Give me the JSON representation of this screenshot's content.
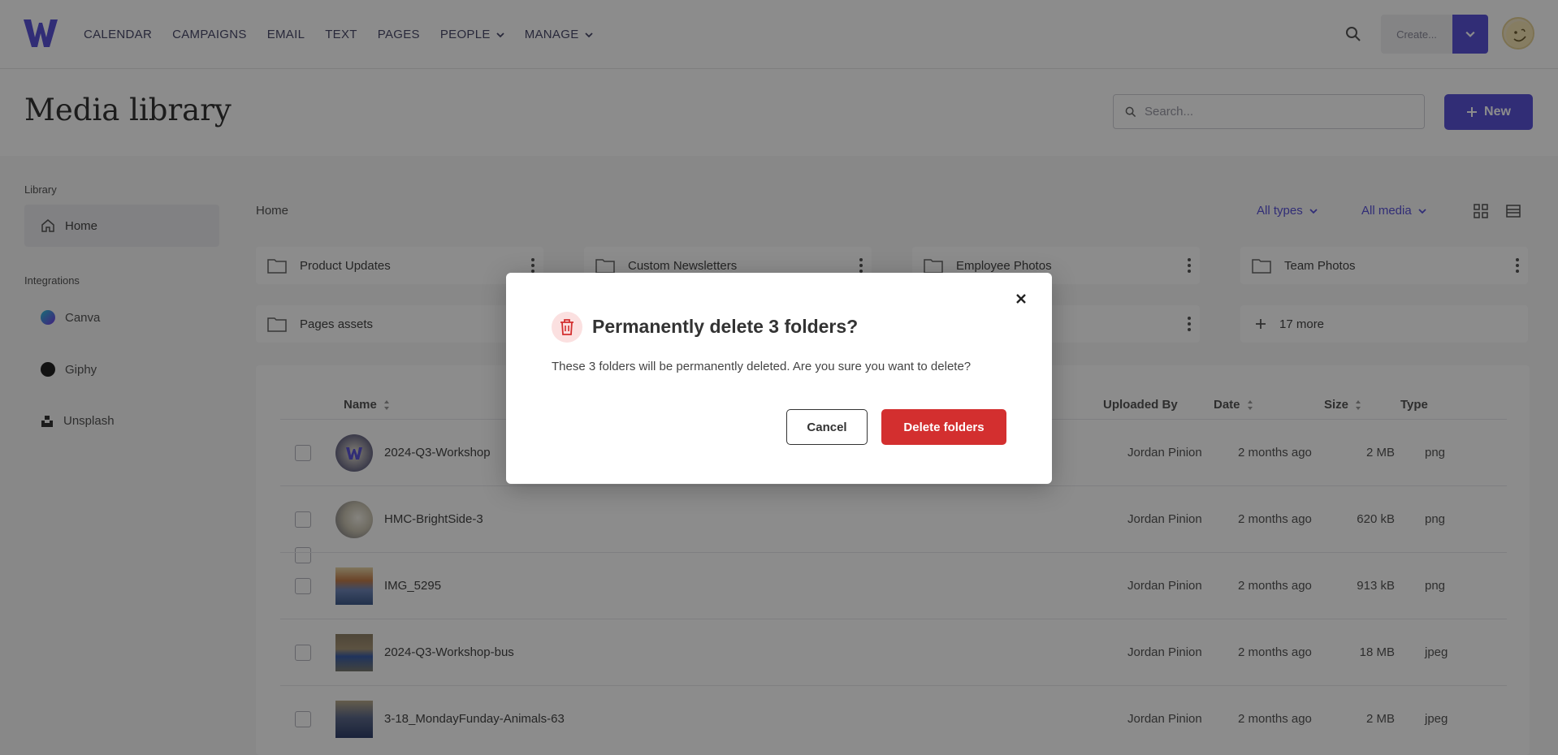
{
  "nav": {
    "items": [
      "CALENDAR",
      "CAMPAIGNS",
      "EMAIL",
      "TEXT",
      "PAGES",
      "PEOPLE",
      "MANAGE"
    ],
    "create_label": "Create..."
  },
  "header": {
    "title": "Media library",
    "search_placeholder": "Search...",
    "new_label": "New"
  },
  "sidebar": {
    "library_label": "Library",
    "home_label": "Home",
    "integrations_label": "Integrations",
    "integrations": [
      "Canva",
      "Giphy",
      "Unsplash"
    ]
  },
  "main": {
    "breadcrumb": "Home",
    "filter_types": "All types",
    "filter_media": "All media",
    "folders": [
      "Product Updates",
      "Custom Newsletters",
      "Employee Photos",
      "Team Photos",
      "Pages assets"
    ],
    "more_label": "17 more",
    "table": {
      "headers": [
        "Name",
        "Uploaded By",
        "Date",
        "Size",
        "Type"
      ],
      "rows": [
        {
          "name": "2024-Q3-Workshop",
          "uploaded_by": "Jordan Pinion",
          "date": "2 months ago",
          "size": "2 MB",
          "type": "png"
        },
        {
          "name": "HMC-BrightSide-3",
          "uploaded_by": "Jordan Pinion",
          "date": "2 months ago",
          "size": "620 kB",
          "type": "png"
        },
        {
          "name": "IMG_5295",
          "uploaded_by": "Jordan Pinion",
          "date": "2 months ago",
          "size": "913 kB",
          "type": "png"
        },
        {
          "name": "2024-Q3-Workshop-bus",
          "uploaded_by": "Jordan Pinion",
          "date": "2 months ago",
          "size": "18 MB",
          "type": "jpeg"
        },
        {
          "name": "3-18_MondayFunday-Animals-63",
          "uploaded_by": "Jordan Pinion",
          "date": "2 months ago",
          "size": "2 MB",
          "type": "jpeg"
        }
      ]
    }
  },
  "modal": {
    "title": "Permanently delete 3 folders?",
    "body": "These 3 folders will be permanently deleted. Are you sure you want to delete?",
    "cancel_label": "Cancel",
    "confirm_label": "Delete folders"
  },
  "colors": {
    "brand": "#5a53d8",
    "danger": "#d32f2f"
  }
}
